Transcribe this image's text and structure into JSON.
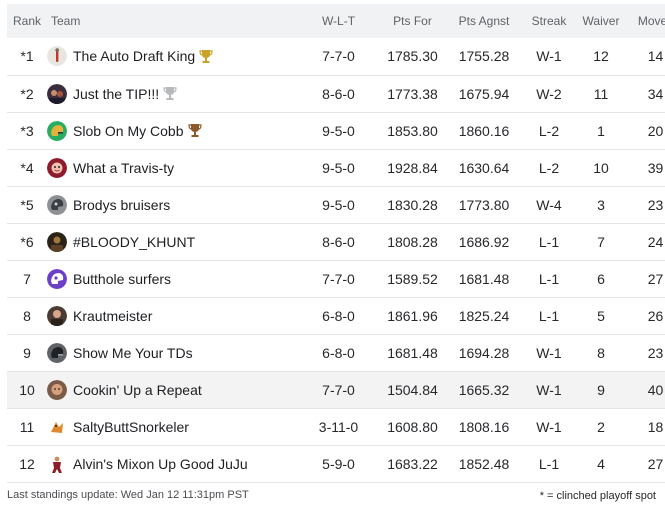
{
  "columns": {
    "rank": "Rank",
    "team": "Team",
    "wlt": "W-L-T",
    "pts_for": "Pts For",
    "pts_against": "Pts Agnst",
    "streak": "Streak",
    "waiver": "Waiver",
    "moves": "Moves"
  },
  "rows": [
    {
      "rank": "*1",
      "team": "The Auto Draft King",
      "wlt": "7-7-0",
      "pts_for": "1785.30",
      "pts_against": "1755.28",
      "streak": "W-1",
      "waiver": "12",
      "moves": "14",
      "trophy": "gold-trophy-icon",
      "avatar": "auto-draft-avatar-icon"
    },
    {
      "rank": "*2",
      "team": "Just the TIP!!!",
      "wlt": "8-6-0",
      "pts_for": "1773.38",
      "pts_against": "1675.94",
      "streak": "W-2",
      "waiver": "11",
      "moves": "34",
      "trophy": "silver-trophy-icon",
      "avatar": "team-photo-avatar-icon"
    },
    {
      "rank": "*3",
      "team": "Slob On My Cobb",
      "wlt": "9-5-0",
      "pts_for": "1853.80",
      "pts_against": "1860.16",
      "streak": "L-2",
      "waiver": "1",
      "moves": "20",
      "trophy": "bronze-trophy-icon",
      "avatar": "green-helmet-avatar-icon"
    },
    {
      "rank": "*4",
      "team": "What a Travis-ty",
      "wlt": "9-5-0",
      "pts_for": "1928.84",
      "pts_against": "1630.64",
      "streak": "L-2",
      "waiver": "10",
      "moves": "39",
      "trophy": null,
      "avatar": "red-face-avatar-icon"
    },
    {
      "rank": "*5",
      "team": "Brodys bruisers",
      "wlt": "9-5-0",
      "pts_for": "1830.28",
      "pts_against": "1773.80",
      "streak": "W-4",
      "waiver": "3",
      "moves": "23",
      "trophy": null,
      "avatar": "gray-helmet-avatar-icon"
    },
    {
      "rank": "*6",
      "team": "#BLOODY_KHUNT",
      "wlt": "8-6-0",
      "pts_for": "1808.28",
      "pts_against": "1686.92",
      "streak": "L-1",
      "waiver": "7",
      "moves": "24",
      "trophy": null,
      "avatar": "dark-photo-avatar-icon"
    },
    {
      "rank": "7",
      "team": "Butthole surfers",
      "wlt": "7-7-0",
      "pts_for": "1589.52",
      "pts_against": "1681.48",
      "streak": "L-1",
      "waiver": "6",
      "moves": "27",
      "trophy": null,
      "avatar": "purple-helmet-avatar-icon"
    },
    {
      "rank": "8",
      "team": "Krautmeister",
      "wlt": "6-8-0",
      "pts_for": "1861.96",
      "pts_against": "1825.24",
      "streak": "L-1",
      "waiver": "5",
      "moves": "26",
      "trophy": null,
      "avatar": "portrait-avatar-icon"
    },
    {
      "rank": "9",
      "team": "Show Me Your TDs",
      "wlt": "6-8-0",
      "pts_for": "1681.48",
      "pts_against": "1694.28",
      "streak": "W-1",
      "waiver": "8",
      "moves": "23",
      "trophy": null,
      "avatar": "dark-helmet-avatar-icon"
    },
    {
      "rank": "10",
      "team": "Cookin' Up a Repeat",
      "wlt": "7-7-0",
      "pts_for": "1504.84",
      "pts_against": "1665.32",
      "streak": "W-1",
      "waiver": "9",
      "moves": "40",
      "trophy": null,
      "avatar": "face-photo-avatar-icon",
      "highlight": true
    },
    {
      "rank": "11",
      "team": "SaltyButtSnorkeler",
      "wlt": "3-11-0",
      "pts_for": "1608.80",
      "pts_against": "1808.16",
      "streak": "W-1",
      "waiver": "2",
      "moves": "18",
      "trophy": null,
      "avatar": "cartoon-avatar-icon"
    },
    {
      "rank": "12",
      "team": "Alvin's Mixon Up Good JuJu",
      "wlt": "5-9-0",
      "pts_for": "1683.22",
      "pts_against": "1852.48",
      "streak": "L-1",
      "waiver": "4",
      "moves": "27",
      "trophy": null,
      "avatar": "action-figure-avatar-icon"
    }
  ],
  "footer": {
    "last_update": "Last standings update: Wed Jan 12 11:31pm PST",
    "legend": "* = clinched playoff spot"
  },
  "colors": {
    "header_bg": "#f1f2f3",
    "highlight_row_bg": "#f3f3f4",
    "gold": "#c9a227",
    "silver": "#b7b9bc",
    "bronze": "#8a5a2b"
  }
}
